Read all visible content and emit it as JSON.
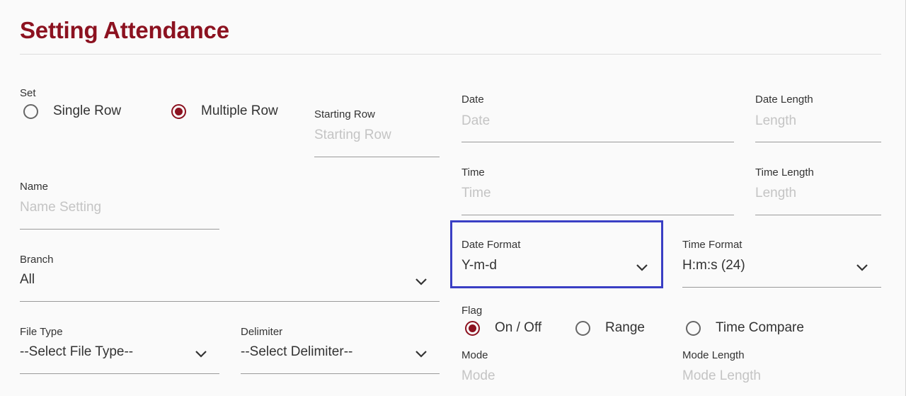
{
  "page": {
    "title": "Setting Attendance"
  },
  "set": {
    "label": "Set",
    "options": [
      {
        "label": "Single Row",
        "selected": false
      },
      {
        "label": "Multiple Row",
        "selected": true
      }
    ]
  },
  "starting_row": {
    "label": "Starting Row",
    "placeholder": "Starting Row"
  },
  "name": {
    "label": "Name",
    "placeholder": "Name Setting"
  },
  "branch": {
    "label": "Branch",
    "value": "All"
  },
  "file_type": {
    "label": "File Type",
    "value": "--Select File Type--"
  },
  "delimiter": {
    "label": "Delimiter",
    "value": "--Select Delimiter--"
  },
  "date": {
    "label": "Date",
    "placeholder": "Date"
  },
  "date_length": {
    "label": "Date Length",
    "placeholder": "Length"
  },
  "time": {
    "label": "Time",
    "placeholder": "Time"
  },
  "time_length": {
    "label": "Time Length",
    "placeholder": "Length"
  },
  "date_format": {
    "label": "Date Format",
    "value": "Y-m-d"
  },
  "time_format": {
    "label": "Time Format",
    "value": "H:m:s (24)"
  },
  "flag": {
    "label": "Flag",
    "options": [
      {
        "label": "On / Off",
        "selected": true
      },
      {
        "label": "Range",
        "selected": false
      },
      {
        "label": "Time Compare",
        "selected": false
      }
    ]
  },
  "mode": {
    "label": "Mode",
    "placeholder": "Mode"
  },
  "mode_length": {
    "label": "Mode Length",
    "placeholder": "Mode Length"
  },
  "colors": {
    "accent": "#8c1220",
    "highlight": "#3a3fc4",
    "underline": "#9a9a9a",
    "placeholder": "#c4c4c4"
  },
  "icons": {
    "dropdown": "chevron-down-icon"
  }
}
